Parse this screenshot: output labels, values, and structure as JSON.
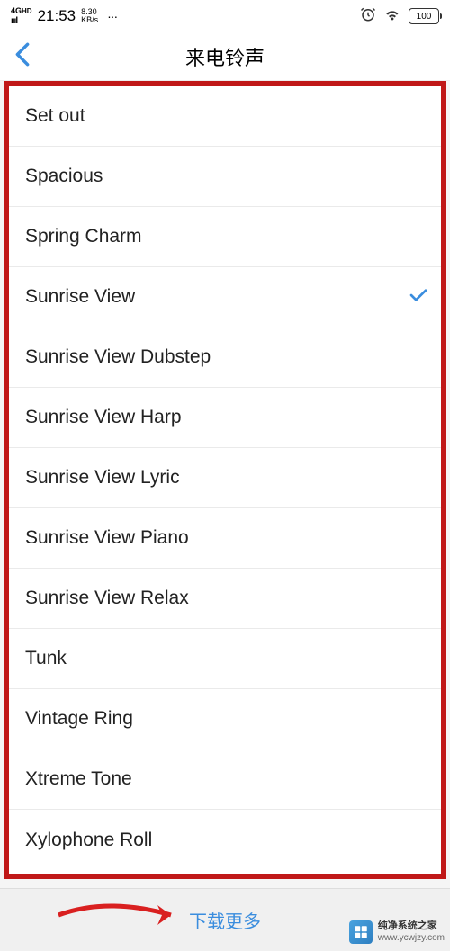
{
  "status_bar": {
    "signal": "4G HD",
    "time": "21:53",
    "speed_top": "8.30",
    "speed_bottom": "KB/s",
    "dots": "···",
    "battery": "100"
  },
  "nav": {
    "title": "来电铃声"
  },
  "ringtones": [
    {
      "name": "Set out",
      "selected": false
    },
    {
      "name": "Spacious",
      "selected": false
    },
    {
      "name": "Spring Charm",
      "selected": false
    },
    {
      "name": "Sunrise View",
      "selected": true
    },
    {
      "name": "Sunrise View Dubstep",
      "selected": false
    },
    {
      "name": "Sunrise View Harp",
      "selected": false
    },
    {
      "name": "Sunrise View Lyric",
      "selected": false
    },
    {
      "name": "Sunrise View Piano",
      "selected": false
    },
    {
      "name": "Sunrise View Relax",
      "selected": false
    },
    {
      "name": "Tunk",
      "selected": false
    },
    {
      "name": "Vintage Ring",
      "selected": false
    },
    {
      "name": "Xtreme Tone",
      "selected": false
    },
    {
      "name": "Xylophone Roll",
      "selected": false
    }
  ],
  "bottom": {
    "download_more": "下载更多"
  },
  "watermark": {
    "name": "纯净系统之家",
    "url": "www.ycwjzy.com"
  },
  "colors": {
    "highlight_border": "#c01818",
    "link_blue": "#3a8dde",
    "back_blue": "#3a8dde",
    "arrow_red": "#d92020"
  }
}
